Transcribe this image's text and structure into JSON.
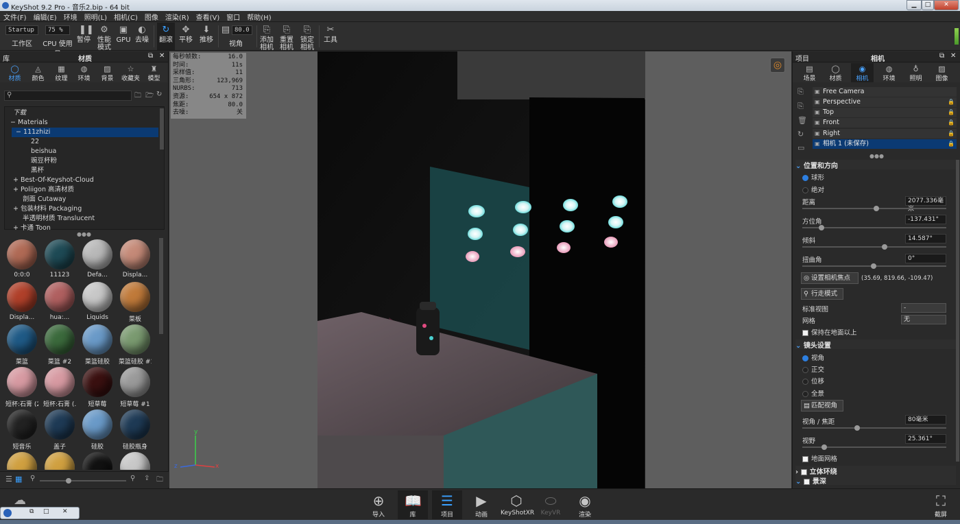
{
  "window": {
    "title": "KeyShot 9.2 Pro  - 音乐2.bip  - 64 bit"
  },
  "menu": [
    "文件(F)",
    "编辑(E)",
    "环境",
    "照明(L)",
    "相机(C)",
    "图像",
    "渲染(R)",
    "查看(V)",
    "窗口",
    "帮助(H)"
  ],
  "toolbar": {
    "workspace_value": "Startup",
    "workspace_label": "工作区",
    "cpu_value": "75 %",
    "cpu_label": "CPU 使用量",
    "pause": "暂停",
    "perf": "性能\n模式",
    "gpu": "GPU",
    "denoise": "去噪",
    "tumble": "翻滚",
    "pan": "平移",
    "dolly": "推移",
    "fov_value": "80.0",
    "fov_label": "视角",
    "add_cam": "添加\n相机",
    "reset_cam": "重置\n相机",
    "lock_cam": "锁定\n相机",
    "tools": "工具"
  },
  "library": {
    "header": "库",
    "subheader": "材质",
    "tabs": [
      "材质",
      "颜色",
      "纹理",
      "环境",
      "背景",
      "收藏夹",
      "模型"
    ],
    "tree": [
      "下载",
      "Materials",
      "111zhizi",
      "22",
      "beishua",
      "豌豆杯粉",
      "黑杯",
      "Best-Of-Keyshot-Cloud",
      "Poliigon 高清材质",
      "剖面 Cutaway",
      "包装材料 Packaging",
      "半透明材质 Translucent",
      "卡通 Toon"
    ],
    "thumbs": [
      {
        "label": "0:0:0",
        "color": "#b06a55"
      },
      {
        "label": "11123",
        "color": "#1e4a55"
      },
      {
        "label": "Defa...",
        "color": "#b9b9b9"
      },
      {
        "label": "Displa...",
        "color": "#c58a78"
      },
      {
        "label": "Displa...",
        "color": "#b0402a"
      },
      {
        "label": "hua:...",
        "color": "#b06060"
      },
      {
        "label": "Liquids",
        "color": "#c8c8c8"
      },
      {
        "label": "菜板",
        "color": "#c07a3a"
      },
      {
        "label": "菜篮",
        "color": "#1f5a86"
      },
      {
        "label": "菜篮 #2",
        "color": "#3b6a3c"
      },
      {
        "label": "菜篮硅胶",
        "color": "#6a9ac8"
      },
      {
        "label": "菜篮硅胶 #1",
        "color": "#7a9a70"
      },
      {
        "label": "短杯:石膏 (2)",
        "color": "#d79aa2"
      },
      {
        "label": "短杯:石膏 (...",
        "color": "#d79aa2"
      },
      {
        "label": "短草莓",
        "color": "#3a1010"
      },
      {
        "label": "短草莓 #1",
        "color": "#9a9a9a"
      },
      {
        "label": "短音乐",
        "color": "#222222"
      },
      {
        "label": "盖子",
        "color": "#1e3a55"
      },
      {
        "label": "硅胶",
        "color": "#6a9ac8"
      },
      {
        "label": "硅胶瓶身",
        "color": "#1e3a55"
      },
      {
        "label": "",
        "color": "#d0a040"
      },
      {
        "label": "",
        "color": "#d0a040"
      },
      {
        "label": "",
        "color": "#111111"
      },
      {
        "label": "",
        "color": "#c8c8c8"
      }
    ]
  },
  "stats": [
    {
      "k": "每秒帧数:",
      "v": "16.0"
    },
    {
      "k": "时间:",
      "v": "11s"
    },
    {
      "k": "采样值:",
      "v": "11"
    },
    {
      "k": "三角形:",
      "v": "123,969"
    },
    {
      "k": "NURBS:",
      "v": "713"
    },
    {
      "k": "资源:",
      "v": "654 x 872"
    },
    {
      "k": "焦距:",
      "v": "80.0"
    },
    {
      "k": "去噪:",
      "v": "关"
    }
  ],
  "axes": {
    "x": "x",
    "y": "y",
    "z": "z"
  },
  "project": {
    "header": "项目",
    "subheader": "相机",
    "tabs": [
      "场景",
      "材质",
      "相机",
      "环境",
      "照明",
      "图像"
    ],
    "cameras": [
      "Free Camera",
      "Perspective",
      "Top",
      "Front",
      "Right",
      "相机 1 (未保存)"
    ],
    "pos_section": "位置和方向",
    "spherical": "球形",
    "absolute": "绝对",
    "distance_label": "距离",
    "distance": "2077.336毫米",
    "azimuth_label": "方位角",
    "azimuth": "-137.431°",
    "incl_label": "倾斜",
    "incl": "14.587°",
    "twist_label": "扭曲角",
    "twist": "0°",
    "set_focus": "设置相机焦点",
    "focus_coords": "(35.69, 819.66, -109.47)",
    "walk": "行走模式",
    "std_view_label": "标准视图",
    "std_view": "-",
    "grid_label": "网格",
    "grid": "无",
    "keep_ground": "保持在地面以上",
    "lens_section": "镜头设置",
    "lens": [
      "视角",
      "正交",
      "位移",
      "全景"
    ],
    "match": "匹配视角",
    "fov_focal_label": "视角 / 焦距",
    "fov_focal": "80毫米",
    "fov_label": "视野",
    "fov": "25.361°",
    "ground_grid": "地面网格",
    "stereo": "立体环绕",
    "dof": "景深"
  },
  "bottom": [
    "导入",
    "库",
    "项目",
    "动画",
    "KeyShotXR",
    "KeyVR",
    "渲染",
    "截屏"
  ]
}
